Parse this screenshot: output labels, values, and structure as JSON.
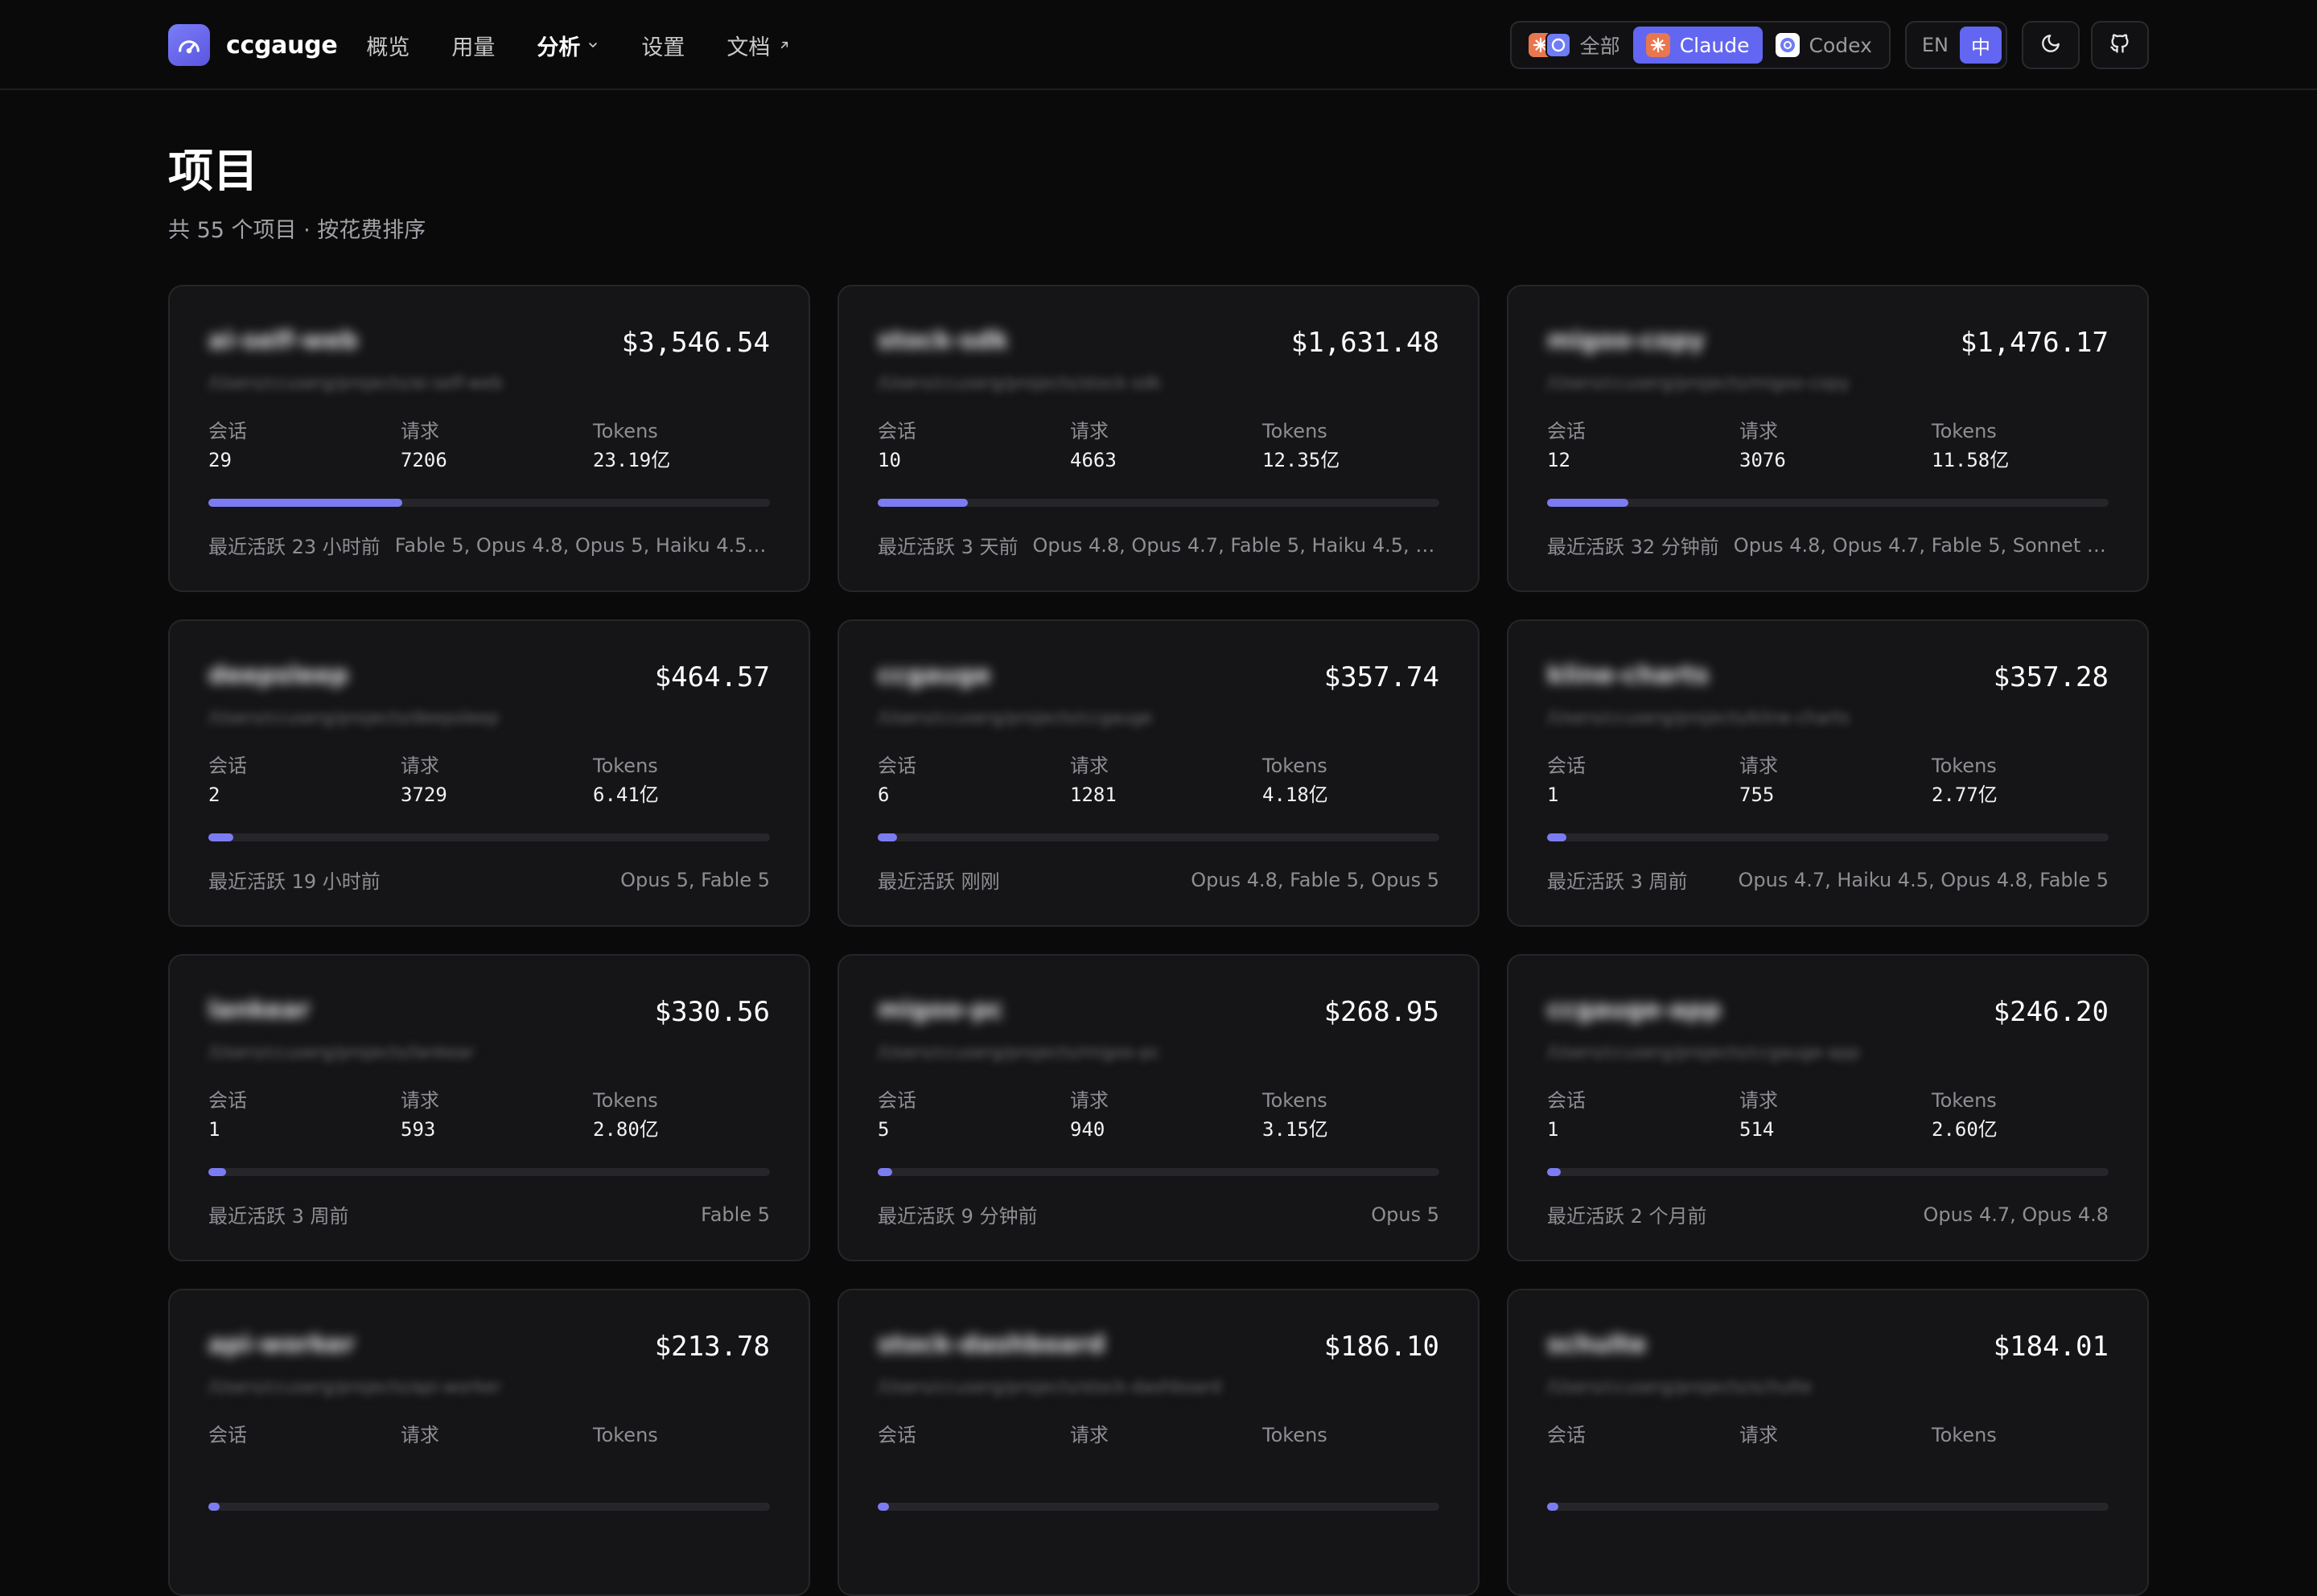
{
  "brand": {
    "name": "ccgauge"
  },
  "nav": {
    "links": [
      {
        "label": "概览"
      },
      {
        "label": "用量"
      },
      {
        "label": "分析"
      },
      {
        "label": "设置"
      },
      {
        "label": "文档"
      }
    ]
  },
  "source_filter": {
    "options": [
      {
        "label": "全部"
      },
      {
        "label": "Claude"
      },
      {
        "label": "Codex"
      }
    ],
    "selected": "Claude"
  },
  "language": {
    "options": [
      {
        "label": "EN"
      },
      {
        "label": "中"
      }
    ],
    "selected": "中"
  },
  "colors": {
    "accent": "#6366f1",
    "bar": "#7c7cf2",
    "claude": "#e8774f",
    "codex": "#6e7cf5"
  },
  "page": {
    "title": "项目",
    "subtitle": "共 55 个项目 · 按花费排序"
  },
  "labels": {
    "sessions": "会话",
    "requests": "请求",
    "tokens": "Tokens"
  },
  "projects": [
    {
      "name": "ai-self-web",
      "path": "/Users/ccuserg/projects/ai-self-web",
      "cost": "$3,546.54",
      "sessions": "29",
      "requests": "7206",
      "tokens": "23.19亿",
      "share": 0.345,
      "last_active": "最近活跃 23 小时前",
      "models": "Fable 5, Opus 4.8, Opus 5, Haiku 4.5, S..."
    },
    {
      "name": "stock-sdk",
      "path": "/Users/ccuserg/projects/stock-sdk",
      "cost": "$1,631.48",
      "sessions": "10",
      "requests": "4663",
      "tokens": "12.35亿",
      "share": 0.16,
      "last_active": "最近活跃 3 天前",
      "models": "Opus 4.8, Opus 4.7, Fable 5, Haiku 4.5, Son..."
    },
    {
      "name": "migoo-copy",
      "path": "/Users/ccuserg/projects/migoo-copy",
      "cost": "$1,476.17",
      "sessions": "12",
      "requests": "3076",
      "tokens": "11.58亿",
      "share": 0.145,
      "last_active": "最近活跃 32 分钟前",
      "models": "Opus 4.8, Opus 4.7, Fable 5, Sonnet 5, ..."
    },
    {
      "name": "deepsleep",
      "path": "/Users/ccuserg/projects/deepsleep",
      "cost": "$464.57",
      "sessions": "2",
      "requests": "3729",
      "tokens": "6.41亿",
      "share": 0.045,
      "last_active": "最近活跃 19 小时前",
      "models": "Opus 5, Fable 5"
    },
    {
      "name": "ccgauge",
      "path": "/Users/ccuserg/projects/ccgauge",
      "cost": "$357.74",
      "sessions": "6",
      "requests": "1281",
      "tokens": "4.18亿",
      "share": 0.035,
      "last_active": "最近活跃 刚刚",
      "models": "Opus 4.8, Fable 5, Opus 5"
    },
    {
      "name": "kline-charts",
      "path": "/Users/ccuserg/projects/kline-charts",
      "cost": "$357.28",
      "sessions": "1",
      "requests": "755",
      "tokens": "2.77亿",
      "share": 0.035,
      "last_active": "最近活跃 3 周前",
      "models": "Opus 4.7, Haiku 4.5, Opus 4.8, Fable 5"
    },
    {
      "name": "lankear",
      "path": "/Users/ccuserg/projects/lankear",
      "cost": "$330.56",
      "sessions": "1",
      "requests": "593",
      "tokens": "2.80亿",
      "share": 0.032,
      "last_active": "最近活跃 3 周前",
      "models": "Fable 5"
    },
    {
      "name": "migoo-pc",
      "path": "/Users/ccuserg/projects/migoo-pc",
      "cost": "$268.95",
      "sessions": "5",
      "requests": "940",
      "tokens": "3.15亿",
      "share": 0.026,
      "last_active": "最近活跃 9 分钟前",
      "models": "Opus 5"
    },
    {
      "name": "ccgauge-app",
      "path": "/Users/ccuserg/projects/ccgauge-app",
      "cost": "$246.20",
      "sessions": "1",
      "requests": "514",
      "tokens": "2.60亿",
      "share": 0.024,
      "last_active": "最近活跃 2 个月前",
      "models": "Opus 4.7, Opus 4.8"
    },
    {
      "name": "api-worker",
      "path": "/Users/ccuserg/projects/api-worker",
      "cost": "$213.78",
      "sessions": "",
      "requests": "",
      "tokens": "",
      "share": 0.02,
      "last_active": "",
      "models": ""
    },
    {
      "name": "stock-dashboard",
      "path": "/Users/ccuserg/projects/stock-dashboard",
      "cost": "$186.10",
      "sessions": "",
      "requests": "",
      "tokens": "",
      "share": 0.018,
      "last_active": "",
      "models": ""
    },
    {
      "name": "schulte",
      "path": "/Users/ccuserg/projects/schulte",
      "cost": "$184.01",
      "sessions": "",
      "requests": "",
      "tokens": "",
      "share": 0.018,
      "last_active": "",
      "models": ""
    }
  ]
}
